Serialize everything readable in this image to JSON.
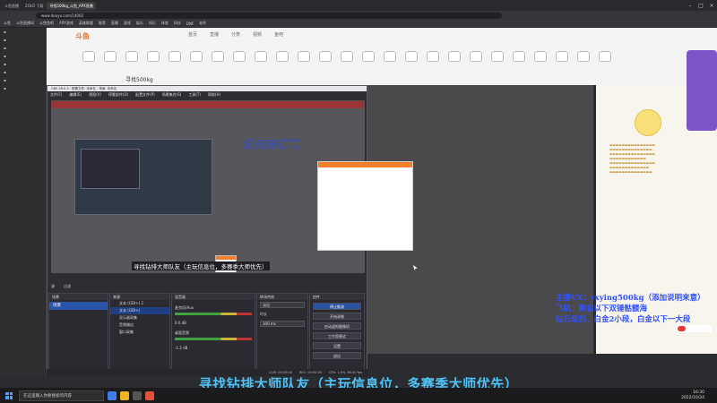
{
  "browser": {
    "tabs": [
      {
        "label": "斗鱼直播",
        "active": false
      },
      {
        "label": "ZOLO 下载",
        "active": false
      },
      {
        "label": "寻找500kg_斗鱼_APX直播",
        "active": true
      }
    ],
    "url": "www.douyu.com/14002",
    "bookmarks": [
      "斗鱼",
      "斗鱼直播间",
      "斗鱼鱼吧",
      "APX游戏",
      "英雄联盟",
      "推荐",
      "直播",
      "游戏",
      "娱乐",
      "知识",
      "体育",
      "科技",
      "DNF",
      "软件"
    ]
  },
  "site": {
    "logo": "斗鱼",
    "nav": [
      "首页",
      "直播",
      "分类",
      "视频",
      "鱼吧"
    ],
    "stream_title": "寻找500kg"
  },
  "obs": {
    "window_title": "OBS 28.0.3 - 配置文件: 未命名 - 场景: 未命名",
    "menu": [
      "文件(F)",
      "编辑(E)",
      "视图(V)",
      "停靠部件(D)",
      "配置文件(P)",
      "场景集合(S)",
      "工具(T)",
      "帮助(H)"
    ],
    "preview_caption": "寻找钻排大师队友（主玩信息位，多赛季大师优先）",
    "preview_overlay_lines": [
      "主播VX：yxying500kg（添加说明来意）",
      "飞机：黄金以下双锤骷髅海",
      "钻石级别、白金2小段，白金以下一大段"
    ],
    "controls_row": [
      "源",
      "过滤"
    ],
    "docks": {
      "scenes": {
        "title": "场景",
        "items": [
          "场景"
        ]
      },
      "sources": {
        "title": "来源",
        "items": [
          "文本 (GDI+) 2",
          "文本 (GDI+)",
          "显示器采集",
          "音频输出",
          "窗口采集"
        ]
      },
      "mixer": {
        "title": "混音器",
        "channels": [
          {
            "name": "麦克风/Aux",
            "db": "0.0 dB"
          },
          {
            "name": "桌面音频",
            "db": "-1.2 dB"
          }
        ]
      },
      "transitions": {
        "title": "转场特效",
        "type": "淡出",
        "duration_label": "时长",
        "duration": "300 ms"
      },
      "controls": {
        "title": "控件",
        "buttons": [
          "停止推流",
          "开始录制",
          "启动虚拟摄像机",
          "工作室模式",
          "设置",
          "退出"
        ]
      }
    },
    "status": [
      "LIVE: 00:00:00",
      "REC: 00:00:00",
      "CPU: 1.5%, 60.00 fps"
    ]
  },
  "overlay": {
    "lines": [
      "主播VX：yxying500kg（添加说明来意）",
      "飞机：黄金以下双锤骷髅海",
      "钻石级别、白金2小段，白金以下一大段"
    ]
  },
  "caption": "寻找钻排大师队友（主玩信息位，多赛季大师优先）",
  "taskbar": {
    "search_placeholder": "在这里输入你要搜索的内容",
    "time": "16:30",
    "date": "2022/10/24"
  },
  "colors": {
    "caption": "#4fc3f7",
    "overlay_text": "#3050ff",
    "obs_selected": "#2954a8",
    "brand_orange": "#f57f2a"
  }
}
